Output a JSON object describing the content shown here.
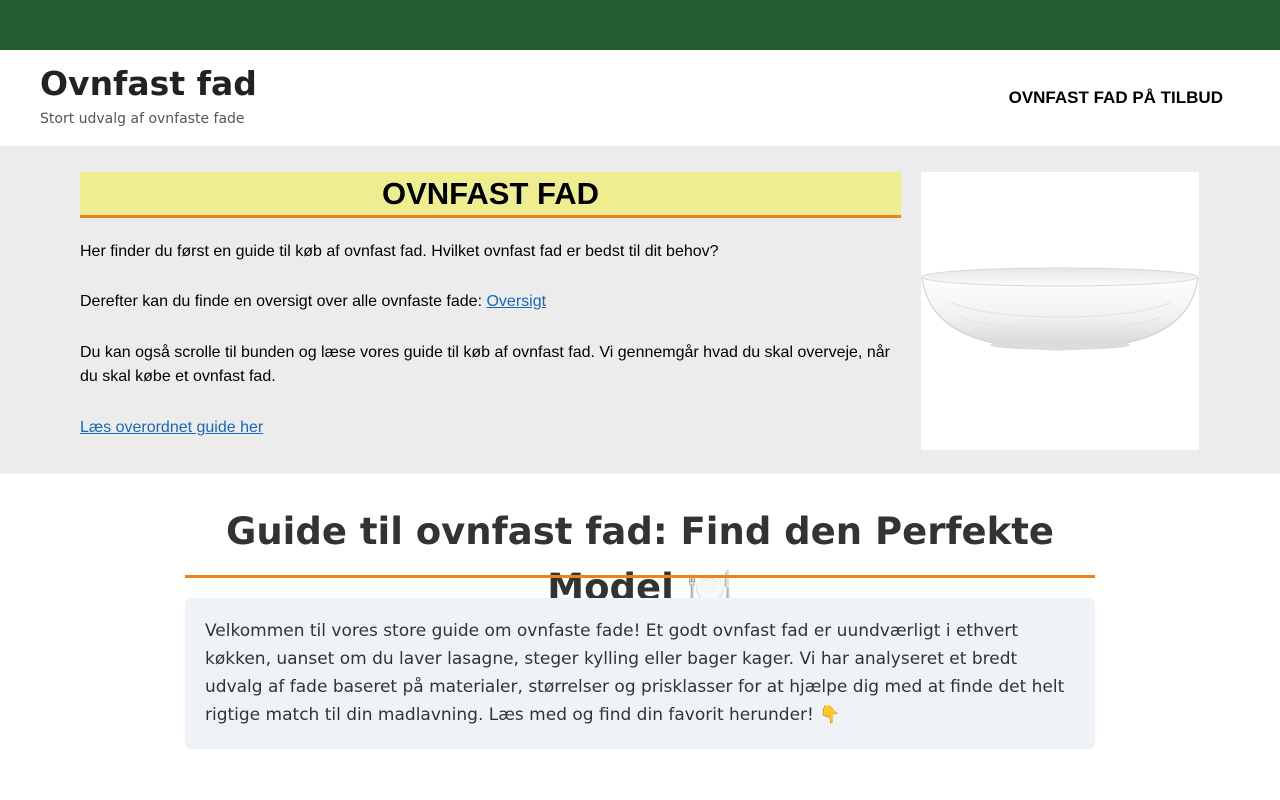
{
  "header": {
    "site_title": "Ovnfast fad",
    "tagline": "Stort udvalg af ovnfaste fade",
    "nav_link": "OVNFAST FAD PÅ TILBUD"
  },
  "hero": {
    "title": "OVNFAST FAD",
    "intro": "Her finder du først en guide til køb af ovnfast fad. Hvilket ovnfast fad er bedst til dit behov?",
    "overview_text": "Derefter kan du finde en oversigt over alle ovnfaste fade: ",
    "overview_link": "Oversigt",
    "scroll_text": "Du kan også scrolle til bunden og læse vores guide til køb af ovnfast fad. Vi gennemgår hvad du skal overveje, når du skal købe et ovnfast fad.",
    "guide_link": "Læs overordnet guide her",
    "image_icon": "white-oval-baking-dish"
  },
  "guide": {
    "title": "Guide til ovnfast fad: Find den Perfekte Model 🍽️",
    "intro": "Velkommen til vores store guide om ovnfaste fade! Et godt ovnfast fad er uundværligt i ethvert køkken, uanset om du laver lasagne, steger kylling eller bager kager. Vi har analyseret et bredt udvalg af fade baseret på materialer, størrelser og prisklasser for at hjælpe dig med at finde det helt rigtige match til din madlavning. Læs med og find din favorit herunder! 👇"
  },
  "colors": {
    "topbar": "#265e33",
    "accent_orange": "#e9841b",
    "hero_title_bg": "#eeee91",
    "link_blue": "#1768b8",
    "hero_bg": "#ececec",
    "guide_box_bg": "#eff2f7"
  }
}
